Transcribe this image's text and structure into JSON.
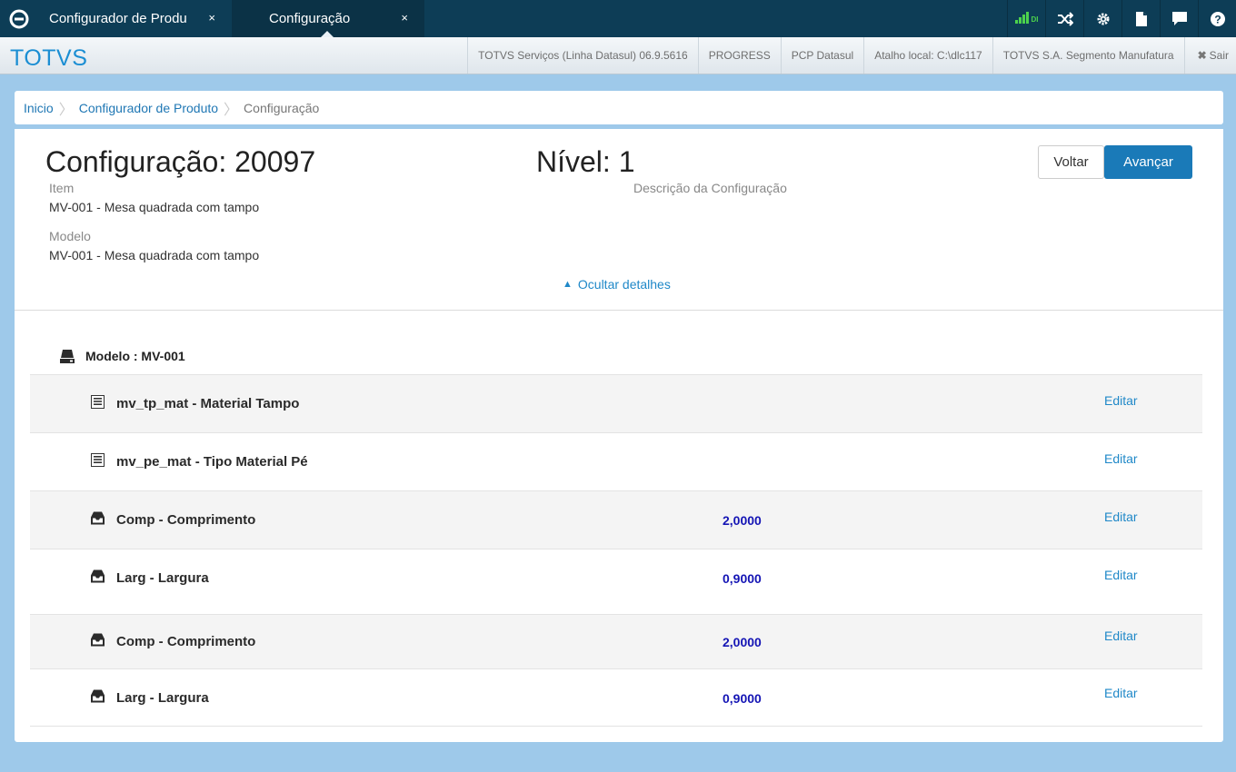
{
  "topbar": {
    "tabs": [
      {
        "label": "Configurador de Produ",
        "close": "×"
      },
      {
        "label": "Configuração",
        "close": "×"
      }
    ],
    "signal_label": "DI",
    "icons": [
      "shuffle-icon",
      "gear-icon",
      "document-icon",
      "chat-icon",
      "help-icon"
    ]
  },
  "subbar": {
    "brand": "TOTVS",
    "items": [
      "TOTVS Serviços (Linha Datasul) 06.9.5616",
      "PROGRESS",
      "PCP Datasul",
      "Atalho local: C:\\dlc117",
      "TOTVS S.A. Segmento Manufatura"
    ],
    "logout": "Sair"
  },
  "breadcrumb": {
    "items": [
      "Inicio",
      "Configurador de Produto"
    ],
    "current": "Configuração"
  },
  "header": {
    "title": "Configuração: 20097",
    "nivel": "Nível: 1",
    "item_label": "Item",
    "item_value": "MV-001 - Mesa quadrada com tampo",
    "modelo_label": "Modelo",
    "modelo_value": "MV-001 - Mesa quadrada com tampo",
    "descricao_label": "Descrição da Configuração",
    "back_button": "Voltar",
    "next_button": "Avançar",
    "toggle_details": "Ocultar detalhes"
  },
  "tree": {
    "model_label": "Modelo : MV-001",
    "rows": [
      {
        "name": "mv_tp_mat - Material Tampo",
        "value": "",
        "action": "Editar",
        "icon": "list-icon"
      },
      {
        "name": "mv_pe_mat - Tipo Material Pé",
        "value": "",
        "action": "Editar",
        "icon": "list-icon"
      },
      {
        "name": "Comp - Comprimento",
        "value": "2,0000",
        "action": "Editar",
        "icon": "tray-icon"
      },
      {
        "name": "Larg - Largura",
        "value": "0,9000",
        "action": "Editar",
        "icon": "tray-icon"
      },
      {
        "name": "Comp - Comprimento",
        "value": "2,0000",
        "action": "Editar",
        "icon": "tray-icon"
      },
      {
        "name": "Larg - Largura",
        "value": "0,9000",
        "action": "Editar",
        "icon": "tray-icon"
      }
    ]
  },
  "colors": {
    "topbar": "#0d3d56",
    "brand": "#1b8ed3",
    "primary_button": "#1a7ab8",
    "link": "#1f88c8",
    "value": "#1515b5",
    "background": "#9ec9ea"
  }
}
